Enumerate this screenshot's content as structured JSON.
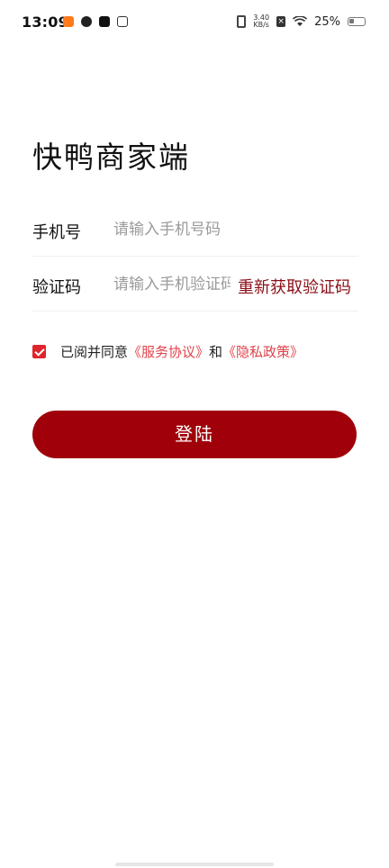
{
  "status_bar": {
    "time": "13:09",
    "network_speed_value": "3.40",
    "network_speed_unit": "KB/s",
    "battery": "25%",
    "icons_left": [
      "taobao-icon",
      "link-icon",
      "tiktok-icon",
      "robot-icon"
    ],
    "icons_right": [
      "vibrate-icon",
      "x-icon",
      "wifi-icon",
      "battery-icon"
    ]
  },
  "page": {
    "title": "快鸭商家端"
  },
  "form": {
    "phone_label": "手机号",
    "phone_placeholder": "请输入手机号码",
    "phone_value": "",
    "code_label": "验证码",
    "code_placeholder": "请输入手机验证码",
    "code_value": "",
    "get_code_label": "重新获取验证码"
  },
  "agreement": {
    "checked": true,
    "prefix": "已阅并同意",
    "service_link": "《服务协议》",
    "and": "和",
    "privacy_link": "《隐私政策》"
  },
  "login_button": {
    "label": "登陆"
  },
  "colors": {
    "accent": "#a0000a",
    "link": "#e0424a",
    "checkbox": "#e0242b",
    "get_code": "#8b0f18"
  }
}
